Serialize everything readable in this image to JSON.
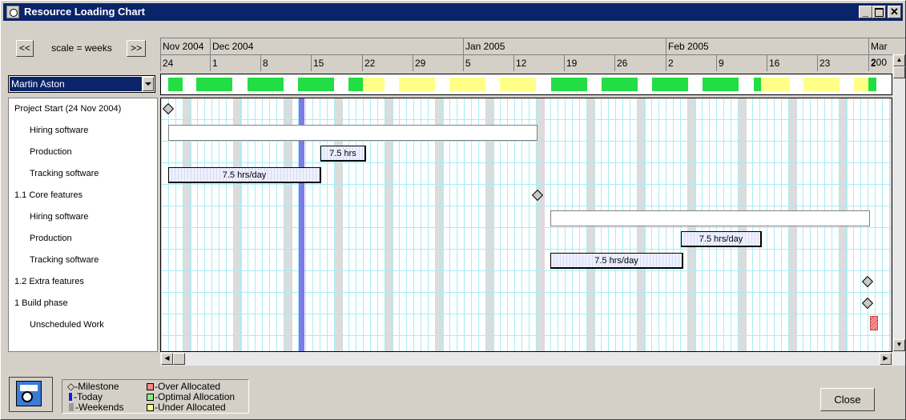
{
  "window": {
    "title": "Resource Loading Chart"
  },
  "toolbar": {
    "prev_label": "<<",
    "scale_label": "scale = weeks",
    "next_label": ">>"
  },
  "resource_select": {
    "value": "Martin Aston"
  },
  "timeline": {
    "months": [
      "Nov 2004",
      "Dec 2004",
      "Jan 2005",
      "Feb 2005",
      "Mar 200"
    ],
    "weeks": [
      "24",
      "1",
      "8",
      "15",
      "22",
      "29",
      "5",
      "12",
      "19",
      "26",
      "2",
      "9",
      "16",
      "23",
      "2"
    ]
  },
  "tasks": [
    {
      "label": "Project Start (24 Nov 2004)"
    },
    {
      "label": "Hiring software"
    },
    {
      "label": "Production"
    },
    {
      "label": "Tracking software"
    },
    {
      "label": "1.1 Core features"
    },
    {
      "label": "Hiring software"
    },
    {
      "label": "Production"
    },
    {
      "label": "Tracking software"
    },
    {
      "label": "1.2 Extra features"
    },
    {
      "label": "1 Build phase"
    },
    {
      "label": "Unscheduled Work"
    }
  ],
  "bar_labels": {
    "production_1": "7.5 hrs",
    "tracking_1": "7.5 hrs/day",
    "production_2": "7.5 hrs/day",
    "tracking_2": "7.5 hrs/day"
  },
  "legend": {
    "milestone": "-Milestone",
    "today": "-Today",
    "weekends": "-Weekends",
    "over": "-Over Allocated",
    "optimal": "-Optimal Allocation",
    "under": "-Under Allocated"
  },
  "colors": {
    "optimal": "#22dd44",
    "under": "#ffff88",
    "over": "#ff8888",
    "today": "#7b7bea",
    "title_bar": "#0a246a"
  },
  "close_label": "Close"
}
